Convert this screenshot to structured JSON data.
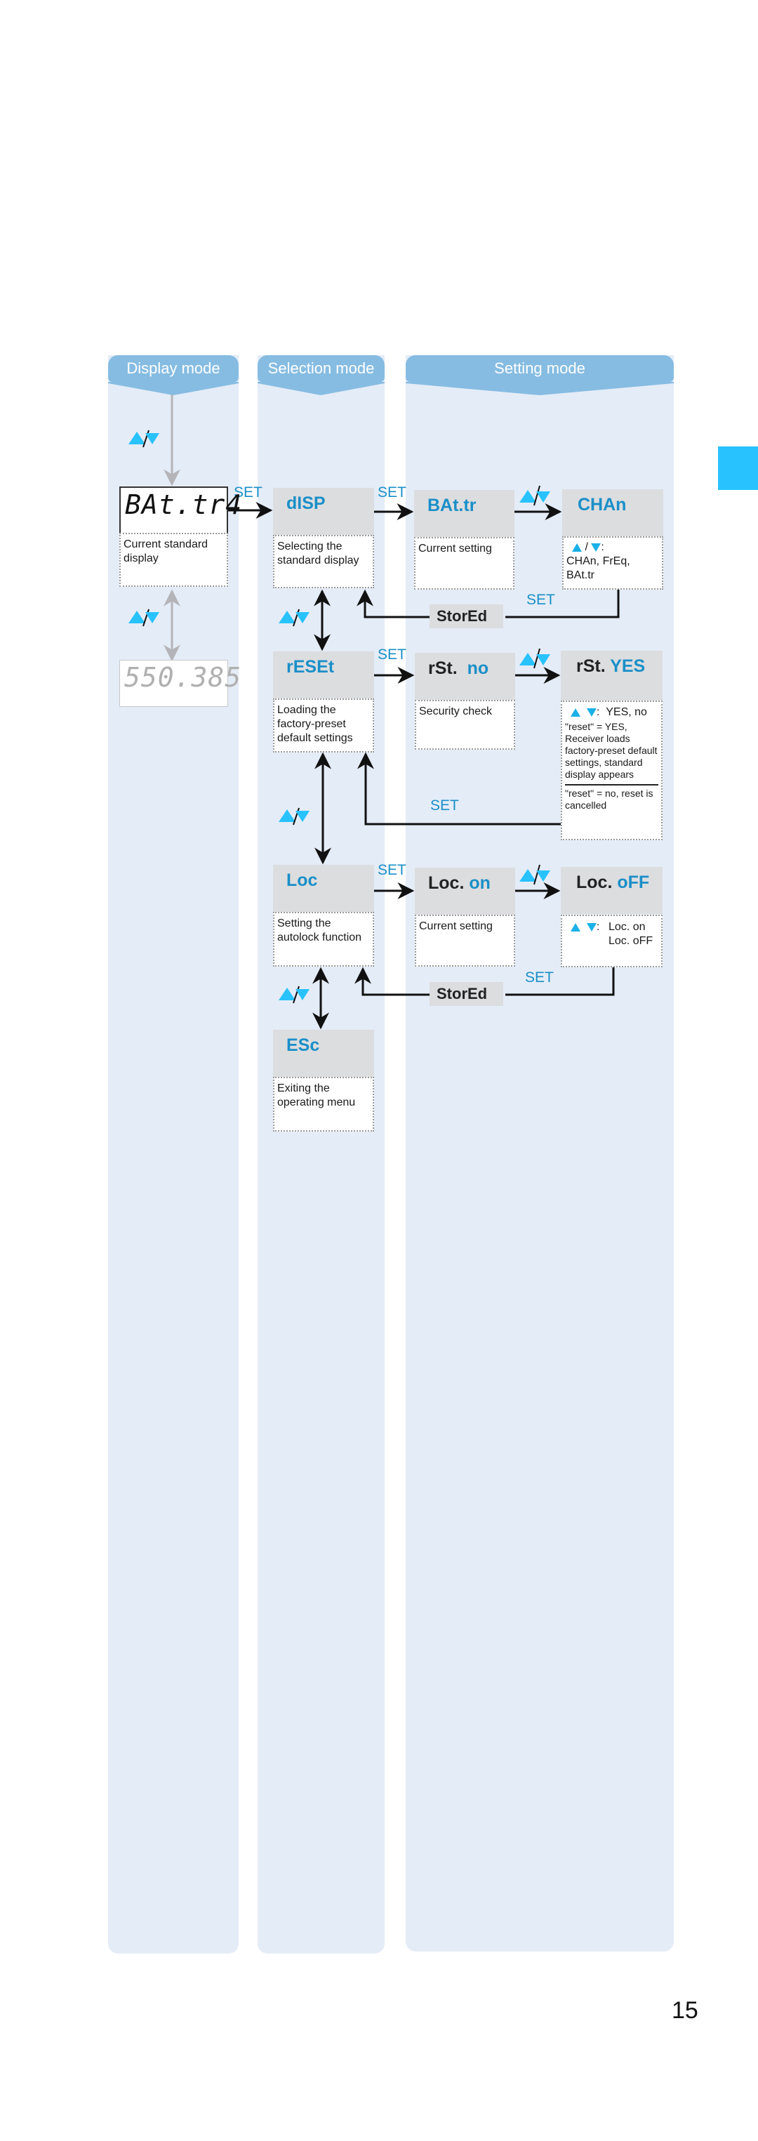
{
  "columns": {
    "display": {
      "title": "Display mode"
    },
    "selection": {
      "title": "Selection mode"
    },
    "setting": {
      "title": "Setting mode"
    }
  },
  "display_mode": {
    "current_display": {
      "lcd": "BAt.tr4",
      "description": "Current standard display"
    },
    "alt_display": {
      "lcd": "550.385"
    },
    "nav_label": "▲/▼"
  },
  "selection_mode": {
    "items": [
      {
        "code": "dISP",
        "description": "Selecting the standard display"
      },
      {
        "code": "rESEt",
        "description": "Loading the factory-preset default settings"
      },
      {
        "code": "Loc",
        "description": "Setting the autolock function"
      },
      {
        "code": "ESc",
        "description": "Exiting the operating menu"
      }
    ]
  },
  "setting_mode": {
    "batr": {
      "code": "BAt.tr",
      "description": "Current setting"
    },
    "chan": {
      "code": "CHAn",
      "keys": ":",
      "options": "CHAn, FrEq, BAt.tr"
    },
    "rst_no": {
      "prefix": "rSt.",
      "value": "no",
      "description": "Security check"
    },
    "rst_yes": {
      "prefix": "rSt.",
      "value": "YES",
      "keys": ":",
      "options": "YES, no",
      "yes_text": "\"reset\" = YES, Receiver loads factory-preset default settings, standard display appears",
      "no_text": "\"reset\" = no, reset is cancelled"
    },
    "loc_on": {
      "prefix": "Loc.",
      "value": "on",
      "description": "Current setting"
    },
    "loc_off": {
      "prefix": "Loc.",
      "value": "oFF",
      "keys": ":",
      "option1": "Loc. on",
      "option2": "Loc. oFF"
    },
    "stored_label": "StorEd"
  },
  "transitions": {
    "set_label": "SET"
  },
  "page_number": "15",
  "colors": {
    "accent": "#1a8fc8",
    "header": "#86bce2",
    "column_bg": "#e4ecf7",
    "tab": "#28c2ff",
    "arrow_key": "#28c2ff"
  }
}
